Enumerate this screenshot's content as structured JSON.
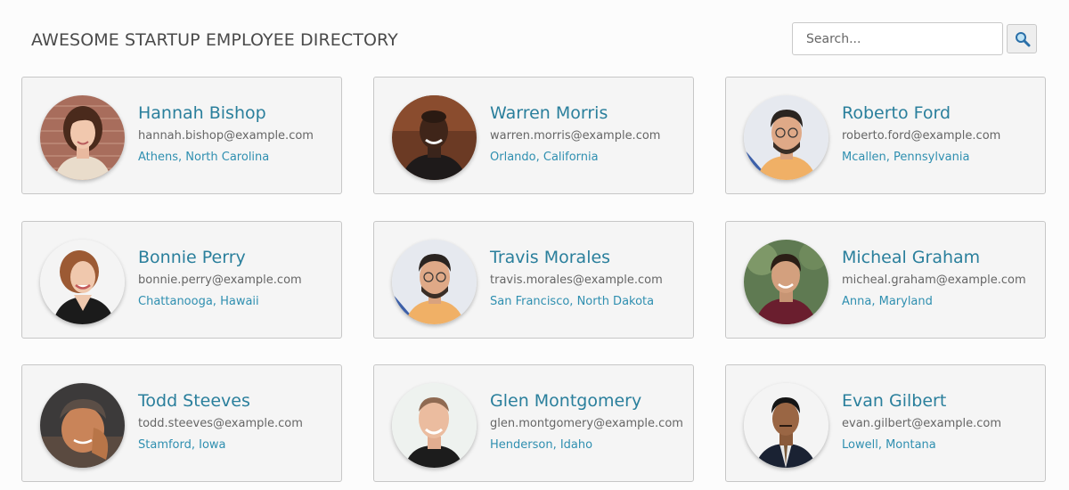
{
  "header": {
    "title": "AWESOME STARTUP EMPLOYEE DIRECTORY",
    "search_placeholder": "Search...",
    "search_icon": "magnifier-icon"
  },
  "colors": {
    "name": "#2a7f9c",
    "location": "#2f8fb0",
    "card_bg": "#f5f5f5",
    "card_border": "#c7c7c7"
  },
  "employees": [
    {
      "name": "Hannah Bishop",
      "email": "hannah.bishop@example.com",
      "location": "Athens, North Carolina"
    },
    {
      "name": "Warren Morris",
      "email": "warren.morris@example.com",
      "location": "Orlando, California"
    },
    {
      "name": "Roberto Ford",
      "email": "roberto.ford@example.com",
      "location": "Mcallen, Pennsylvania"
    },
    {
      "name": "Bonnie Perry",
      "email": "bonnie.perry@example.com",
      "location": "Chattanooga, Hawaii"
    },
    {
      "name": "Travis Morales",
      "email": "travis.morales@example.com",
      "location": "San Francisco, North Dakota"
    },
    {
      "name": "Micheal Graham",
      "email": "micheal.graham@example.com",
      "location": "Anna, Maryland"
    },
    {
      "name": "Todd Steeves",
      "email": "todd.steeves@example.com",
      "location": "Stamford, Iowa"
    },
    {
      "name": "Glen Montgomery",
      "email": "glen.montgomery@example.com",
      "location": "Henderson, Idaho"
    },
    {
      "name": "Evan Gilbert",
      "email": "evan.gilbert@example.com",
      "location": "Lowell, Montana"
    }
  ]
}
